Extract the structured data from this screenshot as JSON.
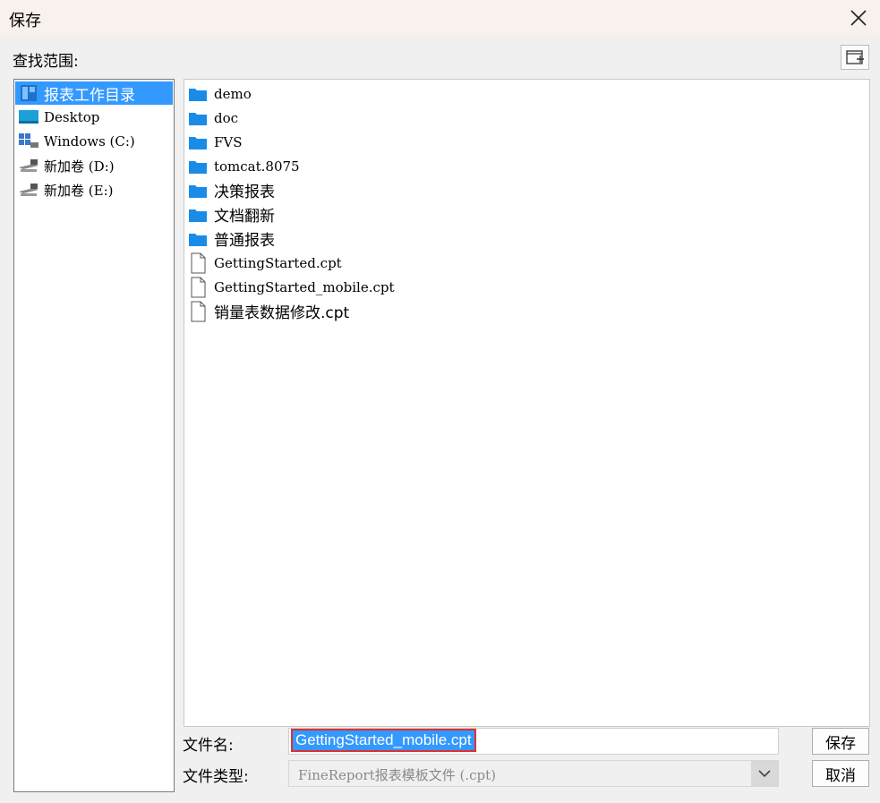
{
  "dialog": {
    "title": "保存"
  },
  "look_in": {
    "label": "查找范围:"
  },
  "sidebar": {
    "items": [
      {
        "label": "报表工作目录",
        "icon": "report-dir-icon",
        "selected": true
      },
      {
        "label": "Desktop",
        "icon": "desktop-icon"
      },
      {
        "label": "Windows (C:)",
        "icon": "windows-drive-icon"
      },
      {
        "label": "新加卷 (D:)",
        "icon": "drive-icon"
      },
      {
        "label": "新加卷 (E:)",
        "icon": "drive-icon"
      }
    ]
  },
  "files": [
    {
      "label": "demo",
      "type": "folder"
    },
    {
      "label": "doc",
      "type": "folder"
    },
    {
      "label": "FVS",
      "type": "folder"
    },
    {
      "label": "tomcat.8075",
      "type": "folder"
    },
    {
      "label": "决策报表",
      "type": "folder"
    },
    {
      "label": "文档翻新",
      "type": "folder"
    },
    {
      "label": "普通报表",
      "type": "folder"
    },
    {
      "label": "GettingStarted.cpt",
      "type": "file"
    },
    {
      "label": "GettingStarted_mobile.cpt",
      "type": "file"
    },
    {
      "label": "销量表数据修改.cpt",
      "type": "file"
    }
  ],
  "filename": {
    "label": "文件名:",
    "value": "GettingStarted_mobile.cpt"
  },
  "filetype": {
    "label": "文件类型:",
    "value": "FineReport报表模板文件 (.cpt)"
  },
  "buttons": {
    "save": "保存",
    "cancel": "取消"
  },
  "colors": {
    "accent": "#3399ff",
    "folder": "#1a8ce8",
    "highlight_border": "#e03030"
  }
}
